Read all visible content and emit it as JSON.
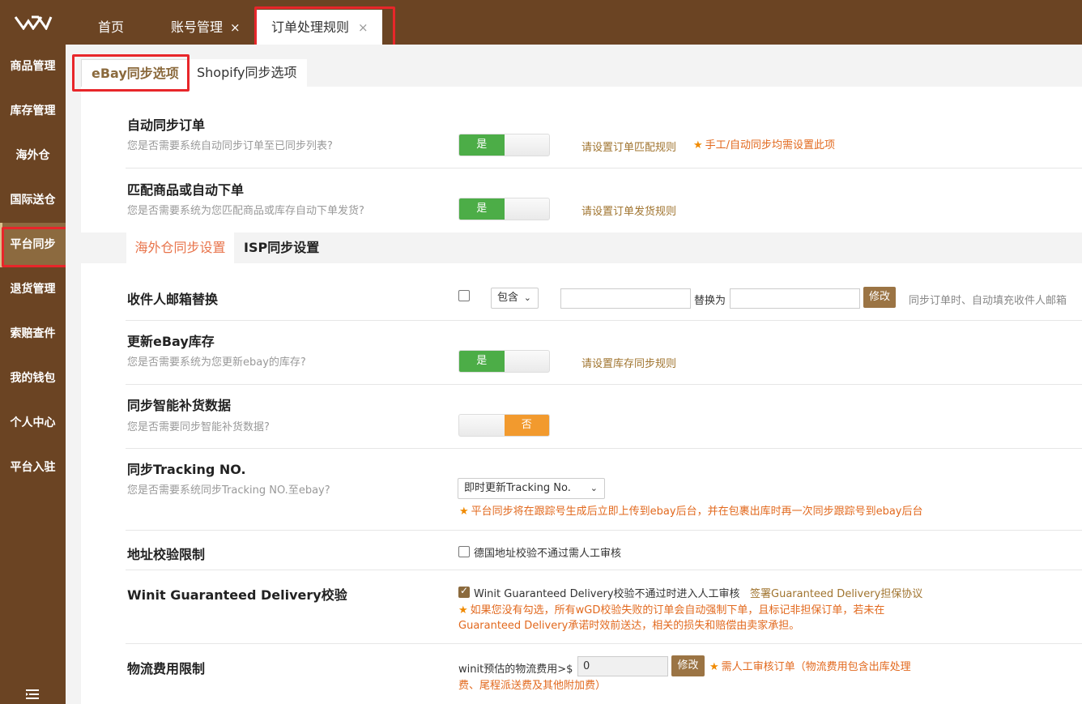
{
  "logo": {
    "icon": "w-logo-icon"
  },
  "tabs": [
    {
      "label": "首页",
      "closable": false
    },
    {
      "label": "账号管理",
      "closable": true
    },
    {
      "label": "订单处理规则",
      "closable": true,
      "active": true
    }
  ],
  "close_glyph": "×",
  "sidebar": {
    "items": [
      {
        "label": "商品管理"
      },
      {
        "label": "库存管理"
      },
      {
        "label": "海外仓"
      },
      {
        "label": "国际送仓"
      },
      {
        "label": "平台同步",
        "active": true
      },
      {
        "label": "退货管理"
      },
      {
        "label": "索赔查件"
      },
      {
        "label": "我的钱包"
      },
      {
        "label": "个人中心"
      },
      {
        "label": "平台入驻"
      }
    ],
    "menu_icon": "collapse-menu-icon"
  },
  "subtabs": [
    {
      "label": "eBay同步选项",
      "active": true
    },
    {
      "label": "Shopify同步选项"
    }
  ],
  "auto_sync": {
    "title": "自动同步订单",
    "subtitle": "您是否需要系统自动同步订单至已同步列表?",
    "toggle": "是",
    "link": "请设置订单匹配规则",
    "note": "手工/自动同步均需设置此项"
  },
  "match": {
    "title": "匹配商品或自动下单",
    "subtitle": "您是否需要系统为您匹配商品或库存自动下单发货?",
    "toggle": "是",
    "link": "请设置订单发货规则"
  },
  "section_tabs": [
    {
      "label": "海外仓同步设置",
      "active": true
    },
    {
      "label": "ISP同步设置"
    }
  ],
  "email": {
    "title": "收件人邮箱替换",
    "select": "包含",
    "replace_label": "替换为",
    "button": "修改",
    "hint": "同步订单时、自动填充收件人邮箱"
  },
  "ebay_stock": {
    "title": "更新eBay库存",
    "subtitle": "您是否需要系统为您更新ebay的库存?",
    "toggle": "是",
    "link": "请设置库存同步规则"
  },
  "replenish": {
    "title": "同步智能补货数据",
    "subtitle": "您是否需要同步智能补货数据?",
    "toggle": "否"
  },
  "tracking": {
    "title": "同步Tracking NO.",
    "subtitle": "您是否需要系统同步Tracking NO.至ebay?",
    "select": "即时更新Tracking No.",
    "note": "平台同步将在跟踪号生成后立即上传到ebay后台，并在包裹出库时再一次同步跟踪号到ebay后台"
  },
  "address": {
    "title": "地址校验限制",
    "checkbox_label": "德国地址校验不通过需人工审核",
    "checked": false
  },
  "guaranteed": {
    "title": "Winit Guaranteed Delivery校验",
    "checkbox_label": "Winit Guaranteed Delivery校验不通过时进入人工审核",
    "checked": true,
    "link": "签署Guaranteed Delivery担保协议",
    "note_line1": "如果您没有勾选，所有wGD校验失败的订单会自动强制下单，且标记非担保订单，若未在",
    "note_line2": "Guaranteed Delivery承诺时效前送达，相关的损失和赔偿由卖家承担。"
  },
  "logistics": {
    "title": "物流费用限制",
    "label": "winit预估的物流费用>$",
    "value": "0",
    "button": "修改",
    "note_line1": "需人工审核订单（物流费用包含出库处理",
    "note_line2": "费、尾程派送费及其他附加费）"
  },
  "star_glyph": "★"
}
